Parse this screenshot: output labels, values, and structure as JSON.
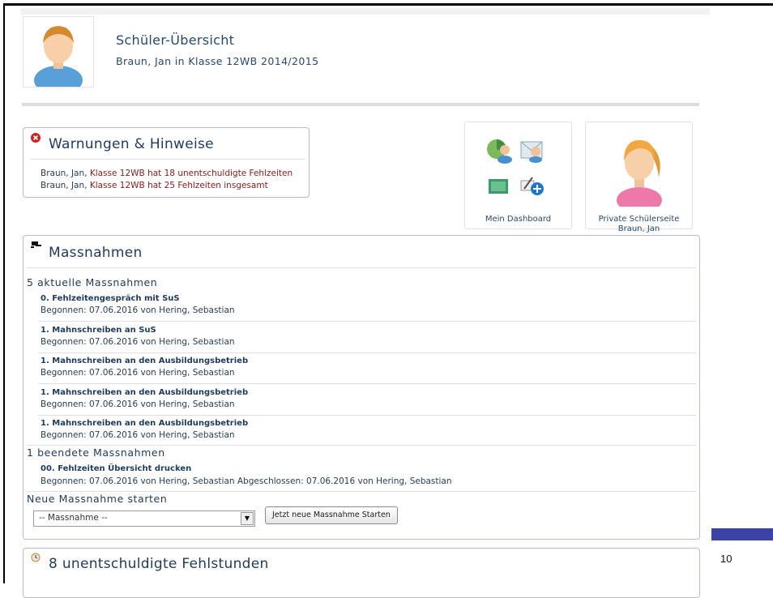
{
  "header": {
    "title": "Schüler-Übersicht",
    "subtitle": "Braun, Jan in Klasse 12WB 2014/2015"
  },
  "warnings": {
    "icon": "error-x-icon",
    "title": "Warnungen & Hinweise",
    "lines": [
      {
        "name": "Braun, Jan,",
        "text": "Klasse 12WB hat 18 unentschuldigte Fehlzeiten"
      },
      {
        "name": "Braun, Jan,",
        "text": "Klasse 12WB hat 25 Fehlzeiten insgesamt"
      }
    ]
  },
  "tiles": {
    "dashboard": {
      "label": "Mein Dashboard"
    },
    "student_page": {
      "label_line1": "Private Schülerseite",
      "label_line2": "Braun, Jan"
    }
  },
  "measures": {
    "icon": "gavel-icon",
    "title": "Massnahmen",
    "current_heading": "5 aktuelle Massnahmen",
    "current": [
      {
        "title": "0. Fehlzeitengespräch mit SuS",
        "meta": "Begonnen: 07.06.2016 von Hering, Sebastian"
      },
      {
        "title": "1. Mahnschreiben an SuS",
        "meta": "Begonnen: 07.06.2016 von Hering, Sebastian"
      },
      {
        "title": "1. Mahnschreiben an den Ausbildungsbetrieb",
        "meta": "Begonnen: 07.06.2016 von Hering, Sebastian"
      },
      {
        "title": "1. Mahnschreiben an den Ausbildungsbetrieb",
        "meta": "Begonnen: 07.06.2016 von Hering, Sebastian"
      },
      {
        "title": "1. Mahnschreiben an den Ausbildungsbetrieb",
        "meta": "Begonnen: 07.06.2016 von Hering, Sebastian"
      }
    ],
    "finished_heading": "1 beendete Massnahmen",
    "finished": [
      {
        "title": "00. Fehlzeiten Übersicht drucken",
        "meta": "Begonnen: 07.06.2016 von Hering, Sebastian Abgeschlossen: 07.06.2016 von Hering, Sebastian"
      }
    ],
    "new_heading": "Neue Massnahme starten",
    "select_value": "-- Massnahme --",
    "start_button": "Jetzt neue Massnahme Starten"
  },
  "absences": {
    "icon": "clock-icon",
    "title": "8 unentschuldigte Fehlstunden"
  },
  "slide": {
    "number": "10",
    "accent_color": "#3c43a6"
  }
}
